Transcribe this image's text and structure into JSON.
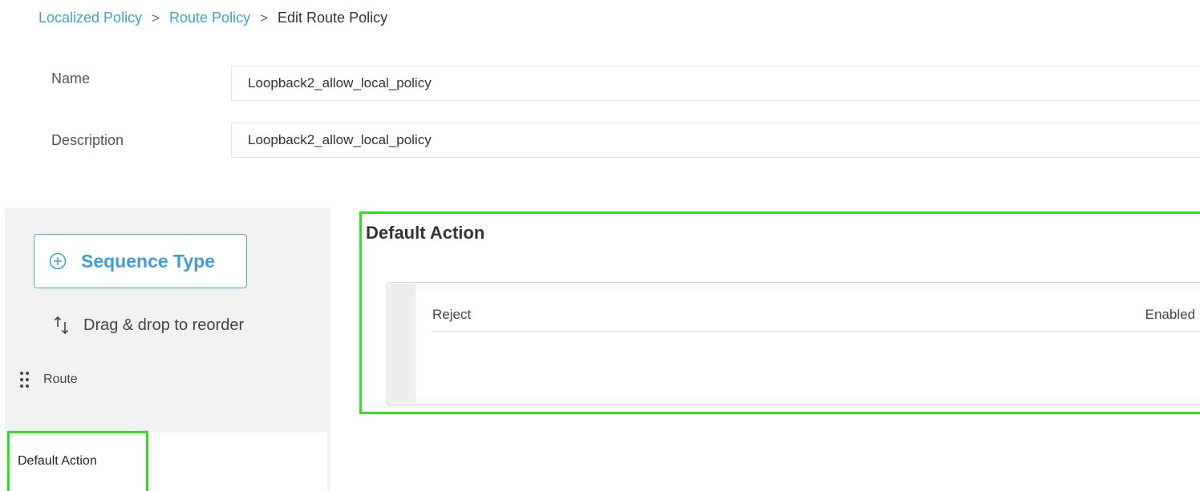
{
  "breadcrumb": {
    "items": [
      "Localized Policy",
      "Route Policy"
    ],
    "separator": ">",
    "current": "Edit Route Policy"
  },
  "form": {
    "name_label": "Name",
    "name_value": "Loopback2_allow_local_policy",
    "description_label": "Description",
    "description_value": "Loopback2_allow_local_policy"
  },
  "sidebar": {
    "sequence_type_label": "Sequence Type",
    "drag_hint": "Drag & drop to reorder",
    "route_label": "Route",
    "default_action_label": "Default Action"
  },
  "main": {
    "section_title": "Default Action",
    "action": {
      "label": "Reject",
      "status": "Enabled"
    }
  },
  "colors": {
    "accent": "#3f9fd4",
    "highlight": "#33dd22"
  },
  "icons": [
    "plus-circle-icon",
    "sort-arrows-icon",
    "drag-grip-icon"
  ]
}
